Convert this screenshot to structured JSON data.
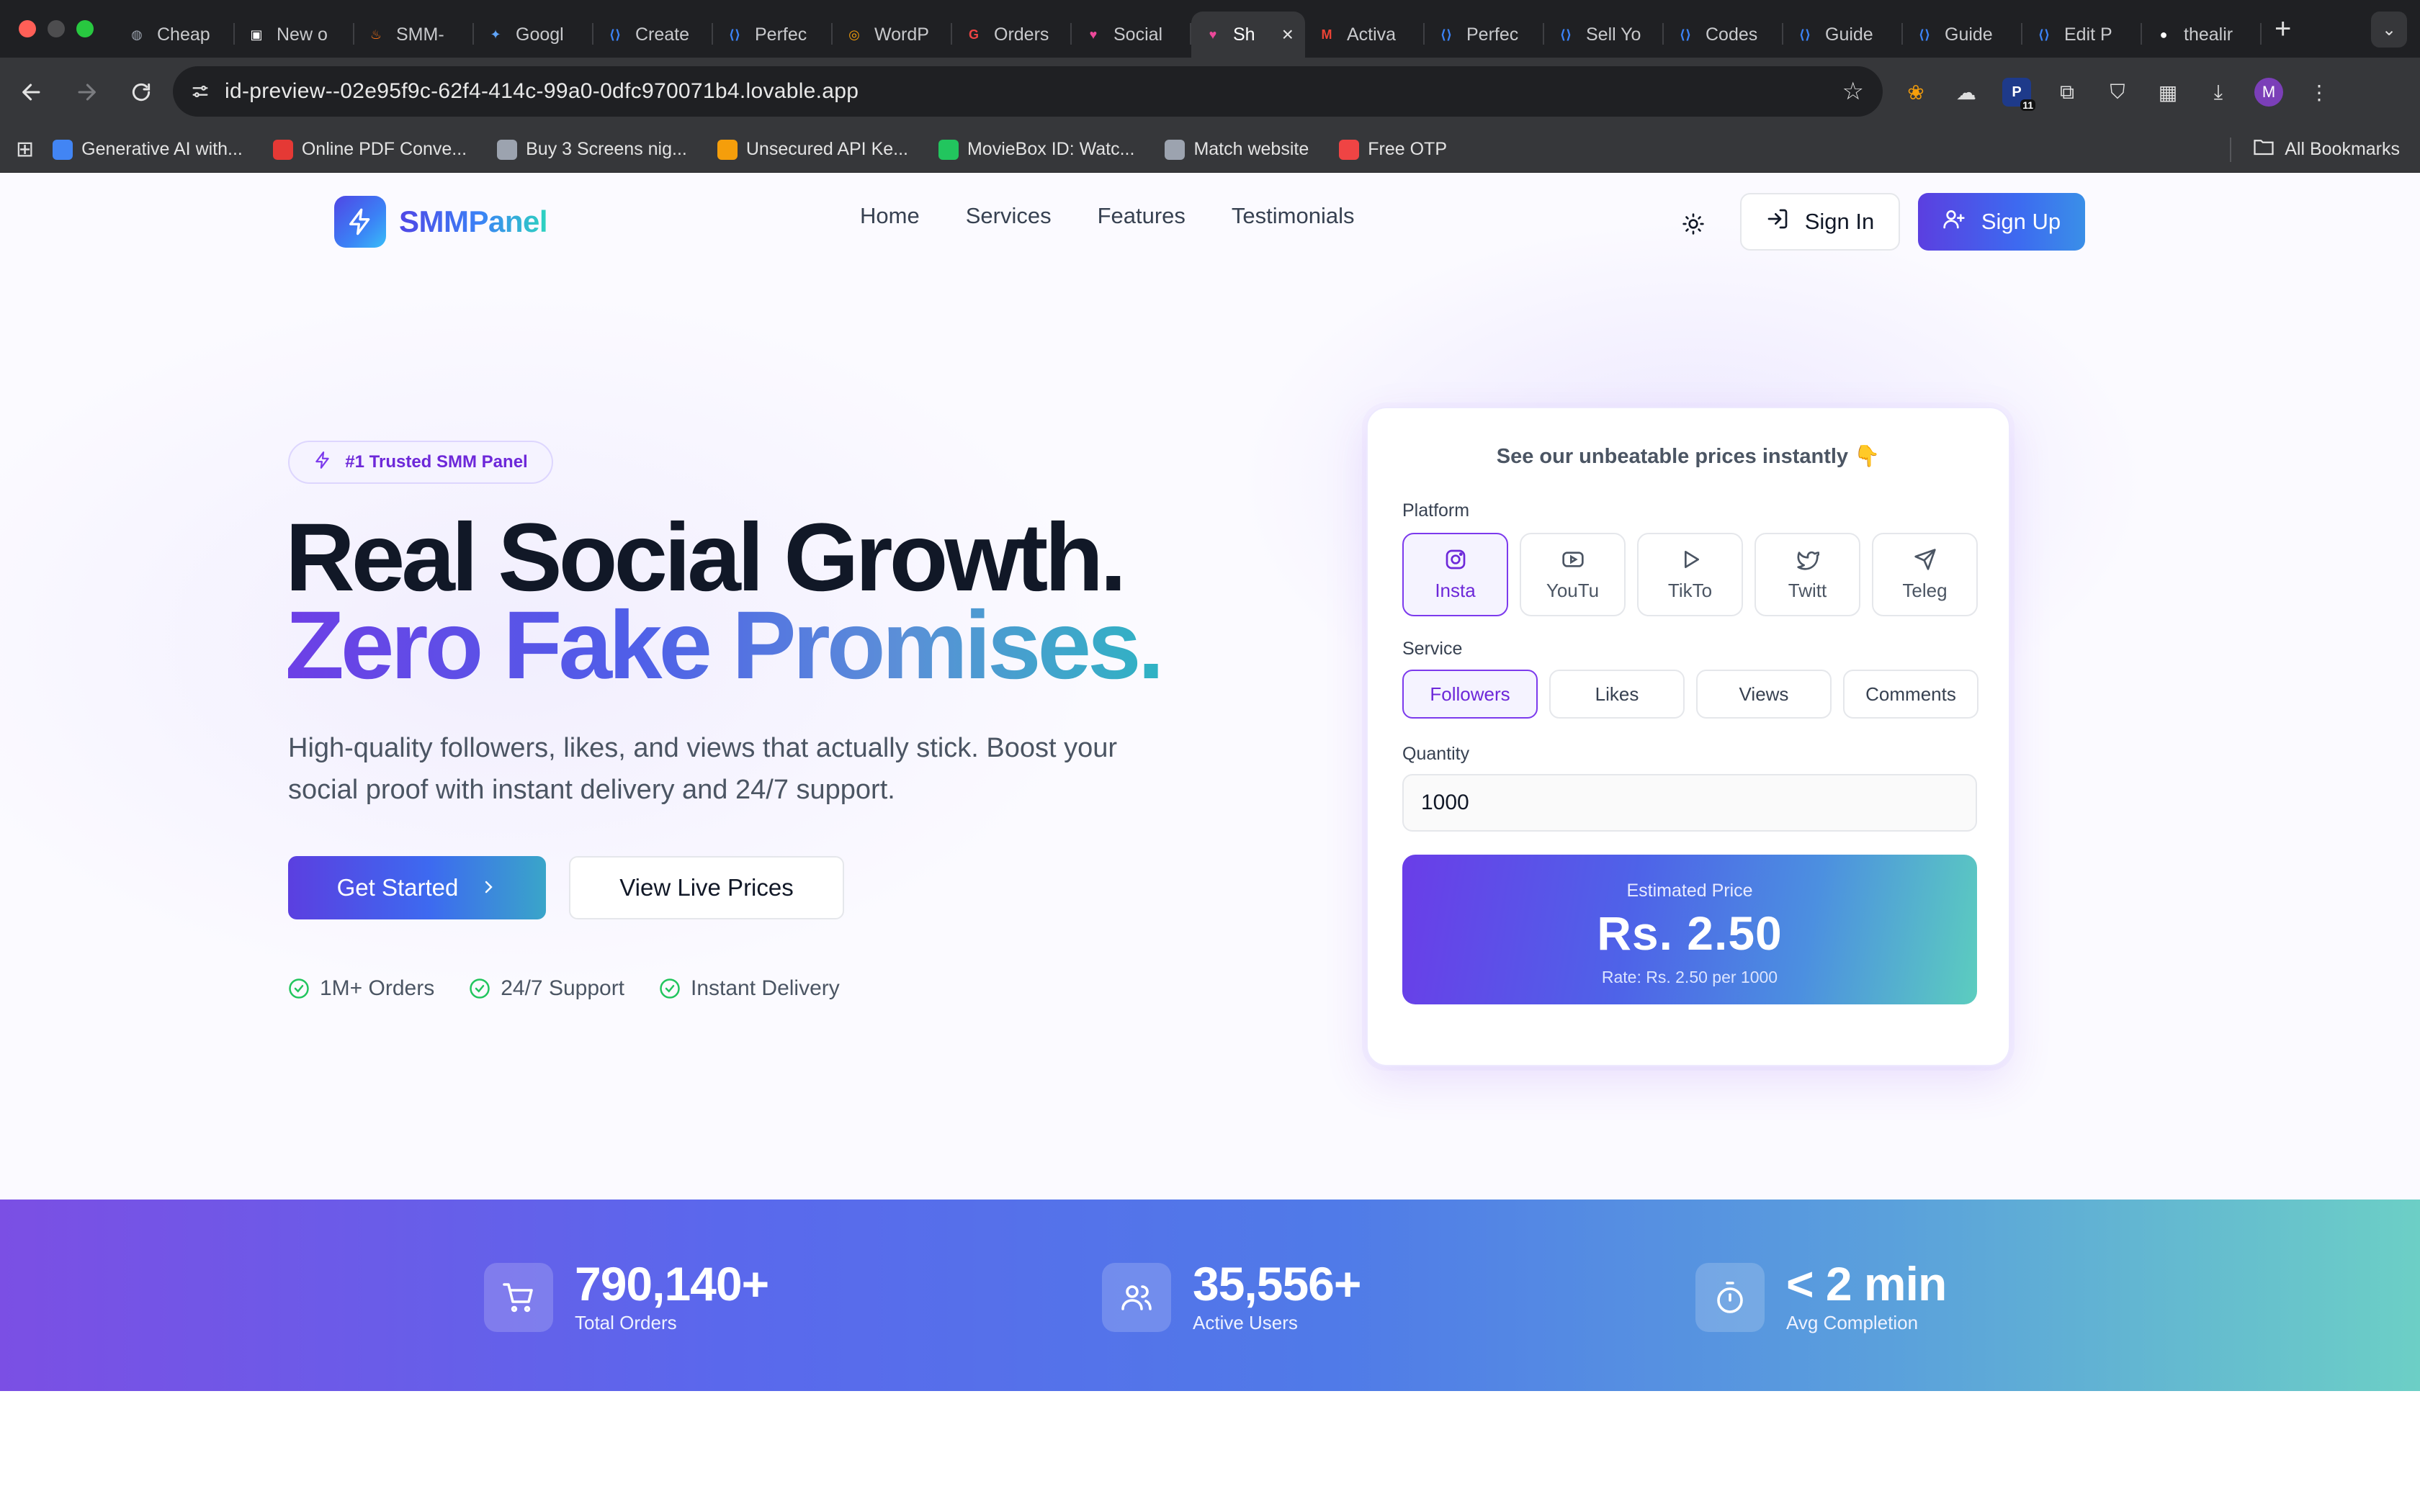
{
  "browser": {
    "tabs": [
      {
        "label": "Cheap",
        "favicon": "globe-icon",
        "color": "#9ca3af"
      },
      {
        "label": "New o",
        "favicon": "notion-icon",
        "color": "#ffffff"
      },
      {
        "label": "SMM-",
        "favicon": "fire-icon",
        "color": "#f97316"
      },
      {
        "label": "Googl",
        "favicon": "gemini-icon",
        "color": "#60a5fa"
      },
      {
        "label": "Create",
        "favicon": "code-icon",
        "color": "#3b82f6"
      },
      {
        "label": "Perfec",
        "favicon": "code-icon",
        "color": "#3b82f6"
      },
      {
        "label": "WordP",
        "favicon": "wordpress-icon",
        "color": "#f59e0b"
      },
      {
        "label": "Orders",
        "favicon": "g-icon",
        "color": "#ef4444"
      },
      {
        "label": "Social",
        "favicon": "lovable-icon",
        "color": "#ec4899"
      },
      {
        "label": "Sh",
        "favicon": "lovable-icon",
        "color": "#ec4899",
        "active": true
      },
      {
        "label": "Activa",
        "favicon": "gmail-icon",
        "color": "#ea4335"
      },
      {
        "label": "Perfec",
        "favicon": "code-icon",
        "color": "#3b82f6"
      },
      {
        "label": "Sell Yo",
        "favicon": "code-icon",
        "color": "#3b82f6"
      },
      {
        "label": "Codes",
        "favicon": "code-icon",
        "color": "#3b82f6"
      },
      {
        "label": "Guide",
        "favicon": "code-icon",
        "color": "#3b82f6"
      },
      {
        "label": "Guide",
        "favicon": "code-icon",
        "color": "#3b82f6"
      },
      {
        "label": "Edit P",
        "favicon": "code-icon",
        "color": "#3b82f6"
      },
      {
        "label": "thealir",
        "favicon": "github-icon",
        "color": "#ffffff"
      }
    ],
    "url": "id-preview--02e95f9c-62f4-414c-99a0-0dfc970071b4.lovable.app",
    "bookmarks": [
      {
        "label": "Generative AI with...",
        "color": "#4285f4"
      },
      {
        "label": "Online PDF Conve...",
        "color": "#e53935"
      },
      {
        "label": "Buy 3 Screens nig...",
        "color": "#9ca3af"
      },
      {
        "label": "Unsecured API Ke...",
        "color": "#f59e0b"
      },
      {
        "label": "MovieBox ID: Watc...",
        "color": "#22c55e"
      },
      {
        "label": "Match website",
        "color": "#9ca3af"
      },
      {
        "label": "Free OTP",
        "color": "#ef4444"
      }
    ],
    "all_bookmarks": "All Bookmarks",
    "profile_initial": "M",
    "ext_badge": "11"
  },
  "site": {
    "brand": "SMMPanel",
    "menu": [
      "Home",
      "Services",
      "Features",
      "Testimonials"
    ],
    "sign_in": "Sign In",
    "sign_up": "Sign Up"
  },
  "hero": {
    "badge": "#1 Trusted SMM Panel",
    "line1": "Real Social Growth.",
    "line2": "Zero Fake Promises.",
    "description": "High-quality followers, likes, and views that actually stick. Boost your social proof with instant delivery and 24/7 support.",
    "cta_primary": "Get Started",
    "cta_secondary": "View Live Prices",
    "perks": [
      "1M+ Orders",
      "24/7 Support",
      "Instant Delivery"
    ]
  },
  "pricing_card": {
    "title": "See our unbeatable prices instantly 👇",
    "platform_label": "Platform",
    "platforms": [
      {
        "label": "Insta",
        "icon": "instagram-icon",
        "selected": true
      },
      {
        "label": "YouTu",
        "icon": "youtube-icon",
        "selected": false
      },
      {
        "label": "TikTo",
        "icon": "play-icon",
        "selected": false
      },
      {
        "label": "Twitt",
        "icon": "twitter-icon",
        "selected": false
      },
      {
        "label": "Teleg",
        "icon": "send-icon",
        "selected": false
      }
    ],
    "service_label": "Service",
    "services": [
      {
        "label": "Followers",
        "selected": true
      },
      {
        "label": "Likes",
        "selected": false
      },
      {
        "label": "Views",
        "selected": false
      },
      {
        "label": "Comments",
        "selected": false
      }
    ],
    "quantity_label": "Quantity",
    "quantity_value": "1000",
    "estimate_label": "Estimated Price",
    "estimate_value": "Rs. 2.50",
    "estimate_rate": "Rate: Rs. 2.50 per 1000"
  },
  "stats": [
    {
      "value": "790,140+",
      "label": "Total Orders",
      "icon": "cart-icon"
    },
    {
      "value": "35,556+",
      "label": "Active Users",
      "icon": "users-icon"
    },
    {
      "value": "< 2 min",
      "label": "Avg Completion",
      "icon": "timer-icon"
    }
  ],
  "colors": {
    "accent": "#5b3fe0",
    "accent_light": "#f5f3ff",
    "success": "#22c55e"
  }
}
